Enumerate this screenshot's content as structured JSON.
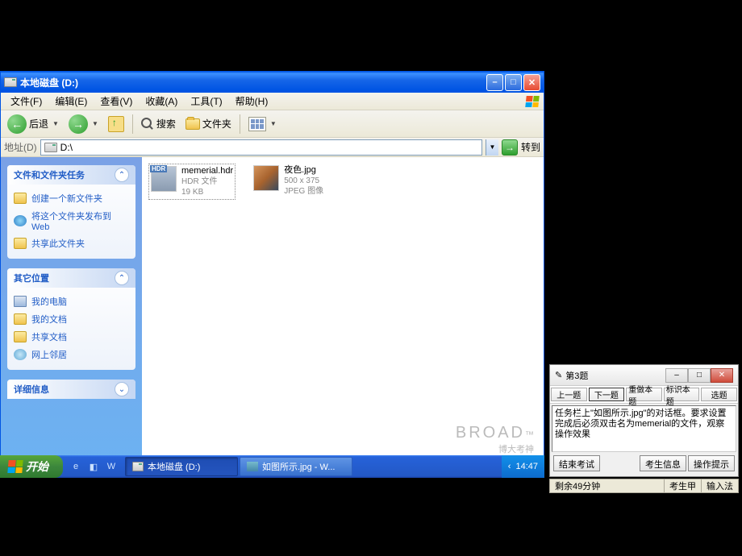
{
  "window": {
    "title": "本地磁盘 (D:)"
  },
  "menubar": {
    "file": "文件(F)",
    "edit": "编辑(E)",
    "view": "查看(V)",
    "favorites": "收藏(A)",
    "tools": "工具(T)",
    "help": "帮助(H)"
  },
  "toolbar": {
    "back": "后退",
    "search": "搜索",
    "folders": "文件夹"
  },
  "addressbar": {
    "label": "地址(D)",
    "value": "D:\\",
    "go": "转到"
  },
  "sidepanel": {
    "tasks": {
      "title": "文件和文件夹任务",
      "items": [
        "创建一个新文件夹",
        "将这个文件夹发布到 Web",
        "共享此文件夹"
      ]
    },
    "otherPlaces": {
      "title": "其它位置",
      "items": [
        "我的电脑",
        "我的文档",
        "共享文档",
        "网上邻居"
      ]
    },
    "details": {
      "title": "详细信息"
    }
  },
  "files": [
    {
      "name": "memerial.hdr",
      "line2": "HDR 文件",
      "line3": "19 KB",
      "type": "hdr"
    },
    {
      "name": "夜色.jpg",
      "line2": "500 x 375",
      "line3": "JPEG 图像",
      "type": "jpg"
    }
  ],
  "watermark": {
    "brand": "BROAD",
    "tm": "™",
    "sub": "博大考神"
  },
  "taskbar": {
    "start": "开始",
    "tasks": [
      {
        "label": "本地磁盘 (D:)",
        "active": true
      },
      {
        "label": "如图所示.jpg - W...",
        "active": false
      }
    ],
    "clock": "14:47"
  },
  "quiz": {
    "title": "第3题",
    "nav": [
      "上一题",
      "下一题",
      "重做本题",
      "标识本题",
      "选题"
    ],
    "body": "任务栏上\"如图所示.jpg\"的对话框。要求设置完成后必须双击名为memerial的文件，观察操作效果",
    "footer": {
      "end": "结束考试",
      "info": "考生信息",
      "hint": "操作提示"
    }
  },
  "status": {
    "remain": "剩余49分钟",
    "student": "考生甲",
    "ime": "输入法"
  }
}
